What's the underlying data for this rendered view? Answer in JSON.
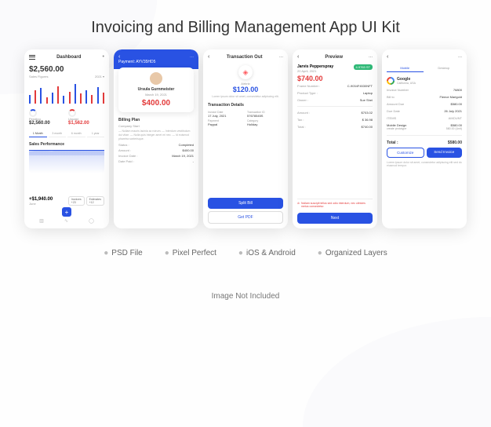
{
  "title": "Invoicing and Billing Management App UI Kit",
  "features": [
    "PSD File",
    "Pixel Perfect",
    "iOS & Android",
    "Organized Layers"
  ],
  "footer_note": "Image Not Included",
  "screen1": {
    "header_title": "Dashboard",
    "amount": "$2,560.00",
    "sub_label": "Sales Figures",
    "year": "2021 ▾",
    "pending_label": "Pending",
    "pending_value": "$2,560.00",
    "unpaid_label": "Unpaid",
    "unpaid_value": "$1,562.00",
    "tabs": [
      "1 Month",
      "3 month",
      "6 month",
      "1 year"
    ],
    "section_title": "Sales Performance",
    "bottom_amount": "+$1,940.00",
    "invoices_label": "Invoices",
    "invoices_count": "+23",
    "estimates_label": "Estimates",
    "estimates_count": "+12"
  },
  "screen2": {
    "payment_ref": "Payment: AYV35HD5",
    "name": "Ursula Gurnmeister",
    "date": "March 19, 2021",
    "amount": "$400.00",
    "plan_title": "Billing Plan",
    "plan_sub": "Company Start",
    "lorem": "— Nullam mauris lacinia ac rutrum.\n— Interdum vestibulum dui vitae.\n— Nulla quis integer amet mi nec.\n— Id euismod pharetra scelerisque.",
    "status_k": "Status :",
    "status_v": "Completed",
    "amount_k": "Amount :",
    "amount_v": "$400.00",
    "invdate_k": "Invoice Date :",
    "invdate_v": "March 19, 2021",
    "paid_k": "Date Paid :",
    "paid_v": "-"
  },
  "screen3": {
    "header_title": "Transaction Out",
    "company": "Airbnb",
    "amount": "$120.00",
    "lorem": "Lorem ipsum dolor sit amet, consectetur adipiscing elit.",
    "details_title": "Transaction Details",
    "date_lbl": "Invoice Date",
    "date_val": "17 July, 2021",
    "id_lbl": "Transaction ID",
    "id_val": "57678545S",
    "pay_lbl": "Payment",
    "pay_val": "Paypal",
    "cat_lbl": "Category",
    "cat_val": "Holiday",
    "btn1": "Split Bill",
    "btn2": "Get PDF"
  },
  "screen4": {
    "header_title": "Preview",
    "name": "Jarvis Pepperspray",
    "date": "20 April, 2021",
    "badge": "4.9763 ST",
    "amount": "$740.00",
    "frame_k": "Frame Number :",
    "frame_v": "C-9034F4530NFT",
    "type_k": "Product Type :",
    "type_v": "Laptop",
    "owner_k": "Owner :",
    "owner_v": "Sue Shei",
    "amount_k": "Amount :",
    "amount_v": "$703.02",
    "tax_k": "Tax :",
    "tax_v": "$ 36.98",
    "total_k": "Total :",
    "total_v": "$740.00",
    "warn": "Nullam suscipit tellus sed odio interdum, nec ultricies metus consectetur.",
    "btn": "Next"
  },
  "screen5": {
    "seg": [
      "Mobile",
      "Desktop"
    ],
    "company": "Google",
    "location": "California, USA",
    "invno_k": "Invoice Number",
    "invno_v": "76800",
    "billto_k": "Bill to",
    "billto_v": "Fleece Marigold",
    "due_k": "Amount Due",
    "due_v": "$580.00",
    "ddate_k": "Due Date",
    "ddate_v": "26 July 2021",
    "items_head_l": "ITEMS",
    "items_head_r": "AMOUNT",
    "item_name": "Mobile Design",
    "item_price": "$580.00",
    "item_sub": "create prototype",
    "item_sub_price": "580.00 (Unit)",
    "total_k": "Total :",
    "total_v": "$580.00",
    "btn1": "Customize",
    "btn2": "Send Invoice",
    "note": "Lorem ipsum dolor sit amet, consectetur adipiscing elit sed do eiusmod tempor."
  }
}
